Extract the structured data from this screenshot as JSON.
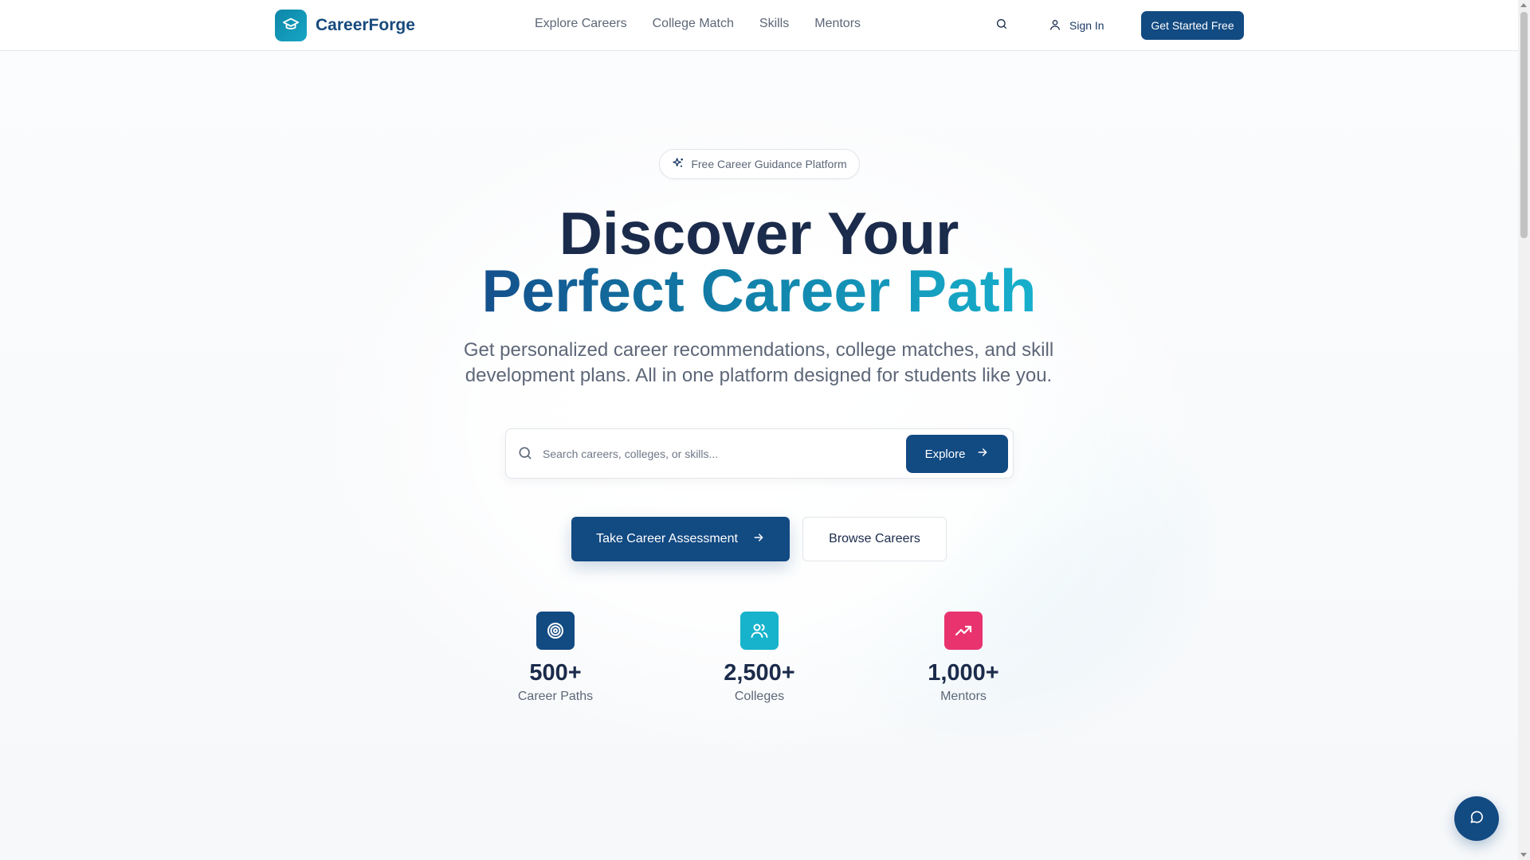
{
  "brand": {
    "name": "CareerForge",
    "accent": "#124a82",
    "logo_icon": "graduation-cap-icon"
  },
  "nav": {
    "items": [
      "Explore Careers",
      "College Match",
      "Skills",
      "Mentors"
    ]
  },
  "header": {
    "search_icon": "search-icon",
    "sign_in": "Sign In",
    "cta": "Get Started Free"
  },
  "hero": {
    "badge": "Free Career Guidance Platform",
    "title_line1": "Discover Your",
    "title_line2": "Perfect Career Path",
    "subtitle": "Get personalized career recommendations, college matches, and skill development plans. All in one platform designed for students like you.",
    "search": {
      "placeholder": "Search careers, colleges, or skills...",
      "value": "",
      "button": "Explore"
    },
    "primary_button": "Take Career Assessment",
    "secondary_button": "Browse Careers"
  },
  "stats": [
    {
      "value": "500+",
      "label": "Career Paths",
      "icon": "target-icon",
      "color": "#124a82"
    },
    {
      "value": "2,500+",
      "label": "Colleges",
      "icon": "users-icon",
      "color": "#17b3cc"
    },
    {
      "value": "1,000+",
      "label": "Mentors",
      "icon": "trending-up-icon",
      "color": "#e8336f"
    }
  ],
  "chat": {
    "icon": "chat-bubble-icon"
  }
}
